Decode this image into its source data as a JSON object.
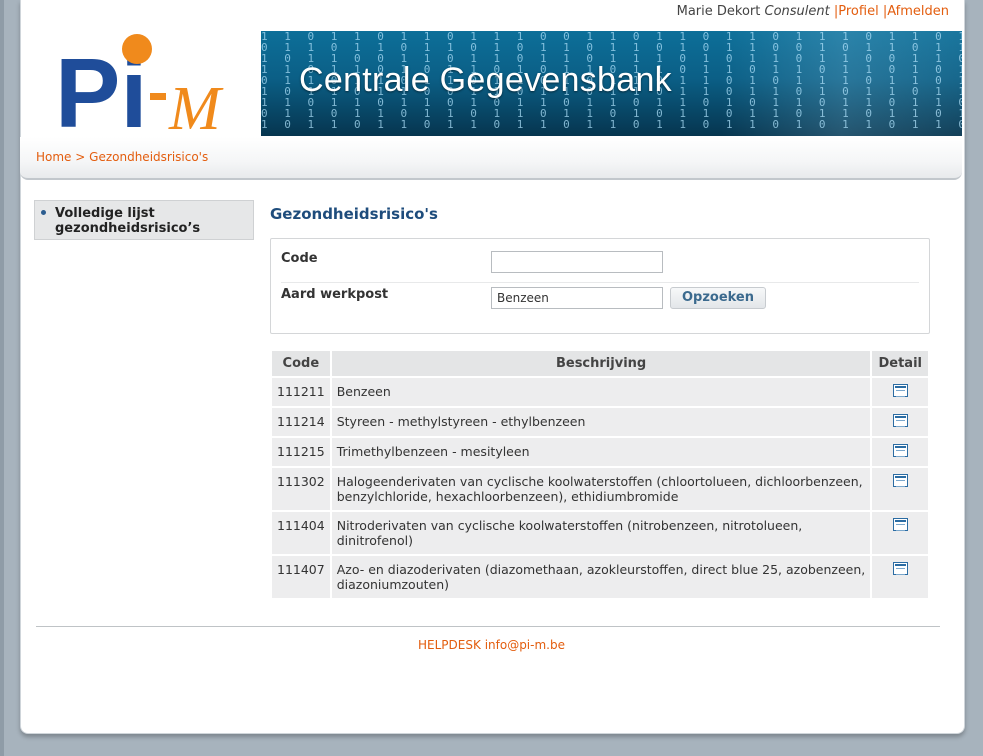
{
  "topbar": {
    "user_name": "Marie Dekort",
    "user_role": "Consulent",
    "profile_link": "Profiel",
    "logout_link": "Afmelden",
    "separator": "|"
  },
  "logo": {
    "text": "Pi-M"
  },
  "banner": {
    "title": "Centrale Gegevensbank"
  },
  "breadcrumb": {
    "home": "Home",
    "separator": ">",
    "current": "Gezondheidsrisico's"
  },
  "sidebar": {
    "items": [
      {
        "label": "Volledige lijst gezondheidsrisico’s"
      }
    ]
  },
  "main": {
    "title": "Gezondheidsrisico's",
    "form": {
      "code_label": "Code",
      "code_value": "",
      "aard_label": "Aard werkpost",
      "aard_value": "Benzeen",
      "search_button": "Opzoeken"
    },
    "table": {
      "headers": [
        "Code",
        "Beschrijving",
        "Detail"
      ],
      "rows": [
        {
          "code": "111211",
          "description": "Benzeen"
        },
        {
          "code": "111214",
          "description": "Styreen - methylstyreen - ethylbenzeen"
        },
        {
          "code": "111215",
          "description": "Trimethylbenzeen - mesityleen"
        },
        {
          "code": "111302",
          "description": "Halogeenderivaten van cyclische koolwaterstoffen (chloortolueen, dichloorbenzeen, benzylchloride, hexachloorbenzeen), ethidiumbromide"
        },
        {
          "code": "111404",
          "description": "Nitroderivaten van cyclische koolwaterstoffen (nitrobenzeen, nitrotolueen, dinitrofenol)"
        },
        {
          "code": "111407",
          "description": "Azo- en diazoderivaten (diazomethaan, azokleurstoffen, direct blue 25, azobenzeen, diazoniumzouten)"
        }
      ],
      "detail_icon": "document-table-icon"
    }
  },
  "footer": {
    "helpdesk_label": "HELPDESK",
    "email": "info@pi-m.be"
  },
  "colors": {
    "accent": "#e35d0e",
    "title_blue": "#1e4c7c",
    "banner": "#0b5f86"
  }
}
